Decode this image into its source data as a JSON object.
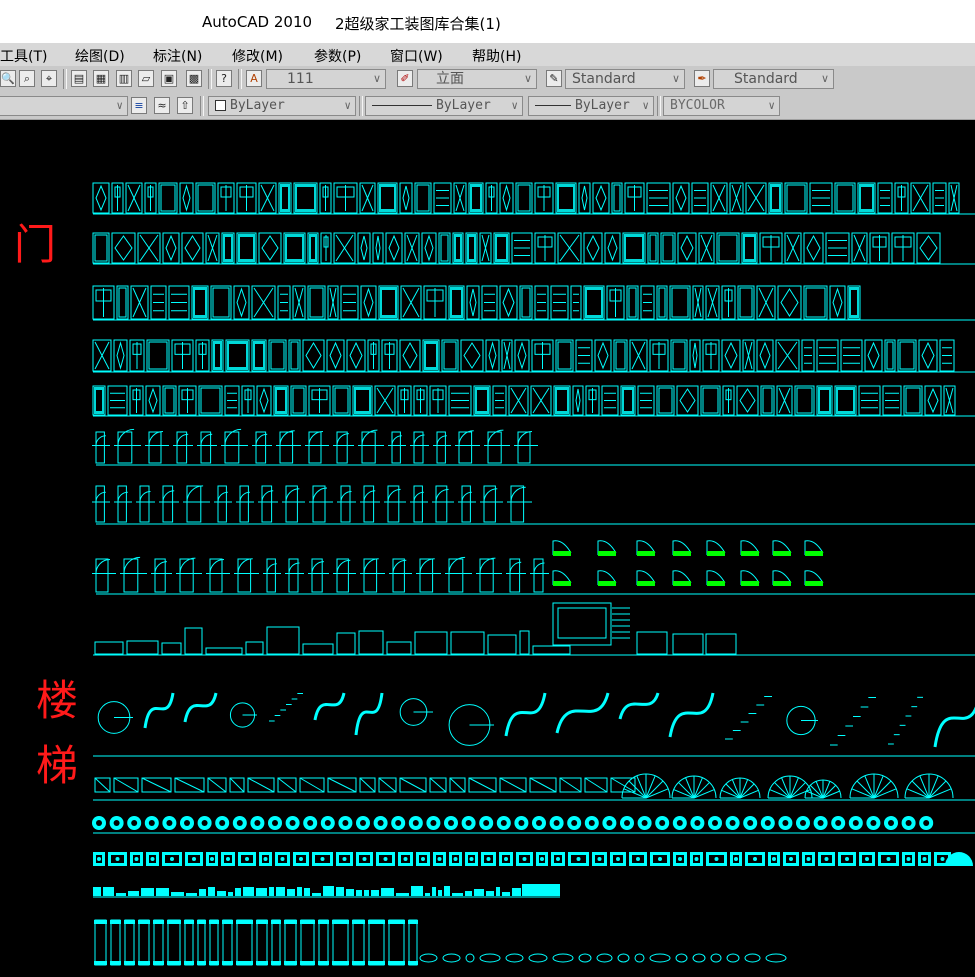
{
  "window": {
    "app_title": "AutoCAD 2010",
    "document_title": "2超级家工装图库合集(1)"
  },
  "menu": [
    {
      "label": "工具(T)"
    },
    {
      "label": "绘图(D)"
    },
    {
      "label": "标注(N)"
    },
    {
      "label": "修改(M)"
    },
    {
      "label": "参数(P)"
    },
    {
      "label": "窗口(W)"
    },
    {
      "label": "帮助(H)"
    }
  ],
  "toolbar1": {
    "text_style": "111",
    "view_name": "立面",
    "dim_style": "Standard",
    "multileader_style": "Standard"
  },
  "toolbar2": {
    "color": "ByLayer",
    "linetype": "ByLayer",
    "lineweight": "ByLayer",
    "plotstyle": "BYCOLOR"
  },
  "labels": {
    "door": "门",
    "stairs_1": "楼",
    "stairs_2": "梯"
  },
  "colors": {
    "background": "#000000",
    "drawing": "#00ffff",
    "highlight": "#00ff00",
    "label": "#ff0000",
    "white_lines": "#ffffff"
  }
}
